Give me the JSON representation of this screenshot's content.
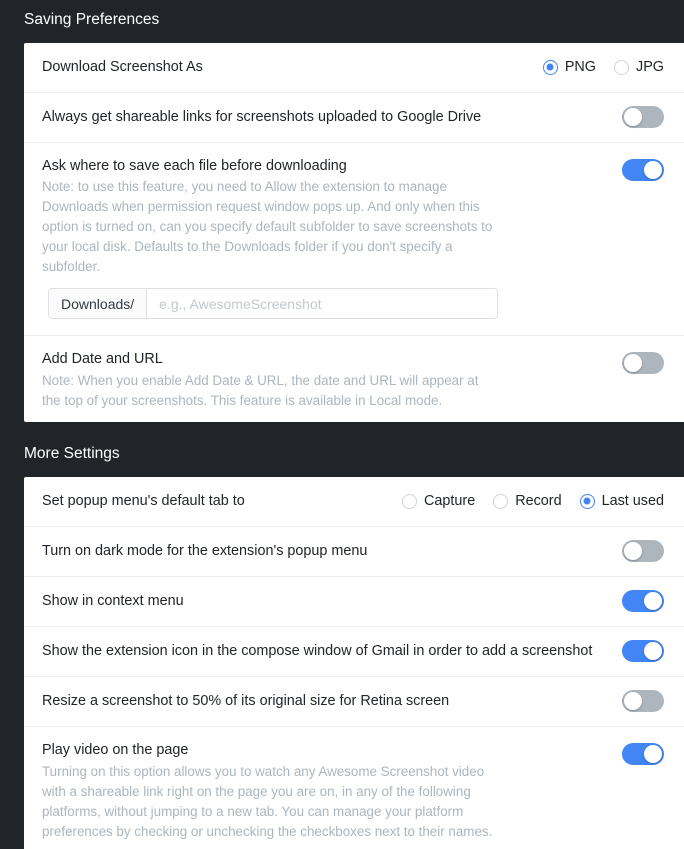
{
  "sections": [
    {
      "heading": "Saving Preferences",
      "rows": [
        {
          "label": "Download Screenshot As",
          "control": "radio",
          "options": [
            {
              "label": "PNG",
              "checked": true
            },
            {
              "label": "JPG",
              "checked": false
            }
          ]
        },
        {
          "label": "Always get shareable links for screenshots uploaded to Google Drive",
          "control": "toggle",
          "on": false
        },
        {
          "label": "Ask where to save each file before downloading",
          "note": "Note: to use this feature, you need to Allow the extension to manage Downloads when permission request window pops up. And only when this option is turned on, can you specify default subfolder to save screenshots to your local disk. Defaults to the Downloads folder if you don't specify a subfolder.",
          "control": "toggle",
          "on": true,
          "input": {
            "prefix": "Downloads/",
            "value": "",
            "placeholder": "e.g., AwesomeScreenshot"
          }
        },
        {
          "label": "Add Date and URL",
          "note": "Note: When you enable Add Date & URL, the date and URL will appear at the top of your screenshots. This feature is available in Local mode.",
          "control": "toggle",
          "on": false
        }
      ]
    },
    {
      "heading": "More Settings",
      "rows": [
        {
          "label": "Set popup menu's default tab to",
          "control": "radio",
          "options": [
            {
              "label": "Capture",
              "checked": false
            },
            {
              "label": "Record",
              "checked": false
            },
            {
              "label": "Last used",
              "checked": true
            }
          ]
        },
        {
          "label": "Turn on dark mode for the extension's popup menu",
          "control": "toggle",
          "on": false
        },
        {
          "label": "Show in context menu",
          "control": "toggle",
          "on": true
        },
        {
          "label": "Show the extension icon in the compose window of Gmail in order to add a screenshot",
          "control": "toggle",
          "on": true
        },
        {
          "label": "Resize a screenshot to 50% of its original size for Retina screen",
          "control": "toggle",
          "on": false
        },
        {
          "label": "Play video on the page",
          "note": "Turning on this option allows you to watch any Awesome Screenshot video with a shareable link right on the page you are on, in any of the following platforms, without jumping to a new tab. You can manage your platform preferences by checking or unchecking the checkboxes next to their names.",
          "control": "toggle",
          "on": true
        }
      ]
    }
  ],
  "colors": {
    "background": "#212529",
    "card": "#ffffff",
    "accent": "#4285f4",
    "toggle_off": "#adb5bd",
    "label_text": "#212529",
    "note_text": "#adb5bd",
    "divider": "#eceef0"
  }
}
